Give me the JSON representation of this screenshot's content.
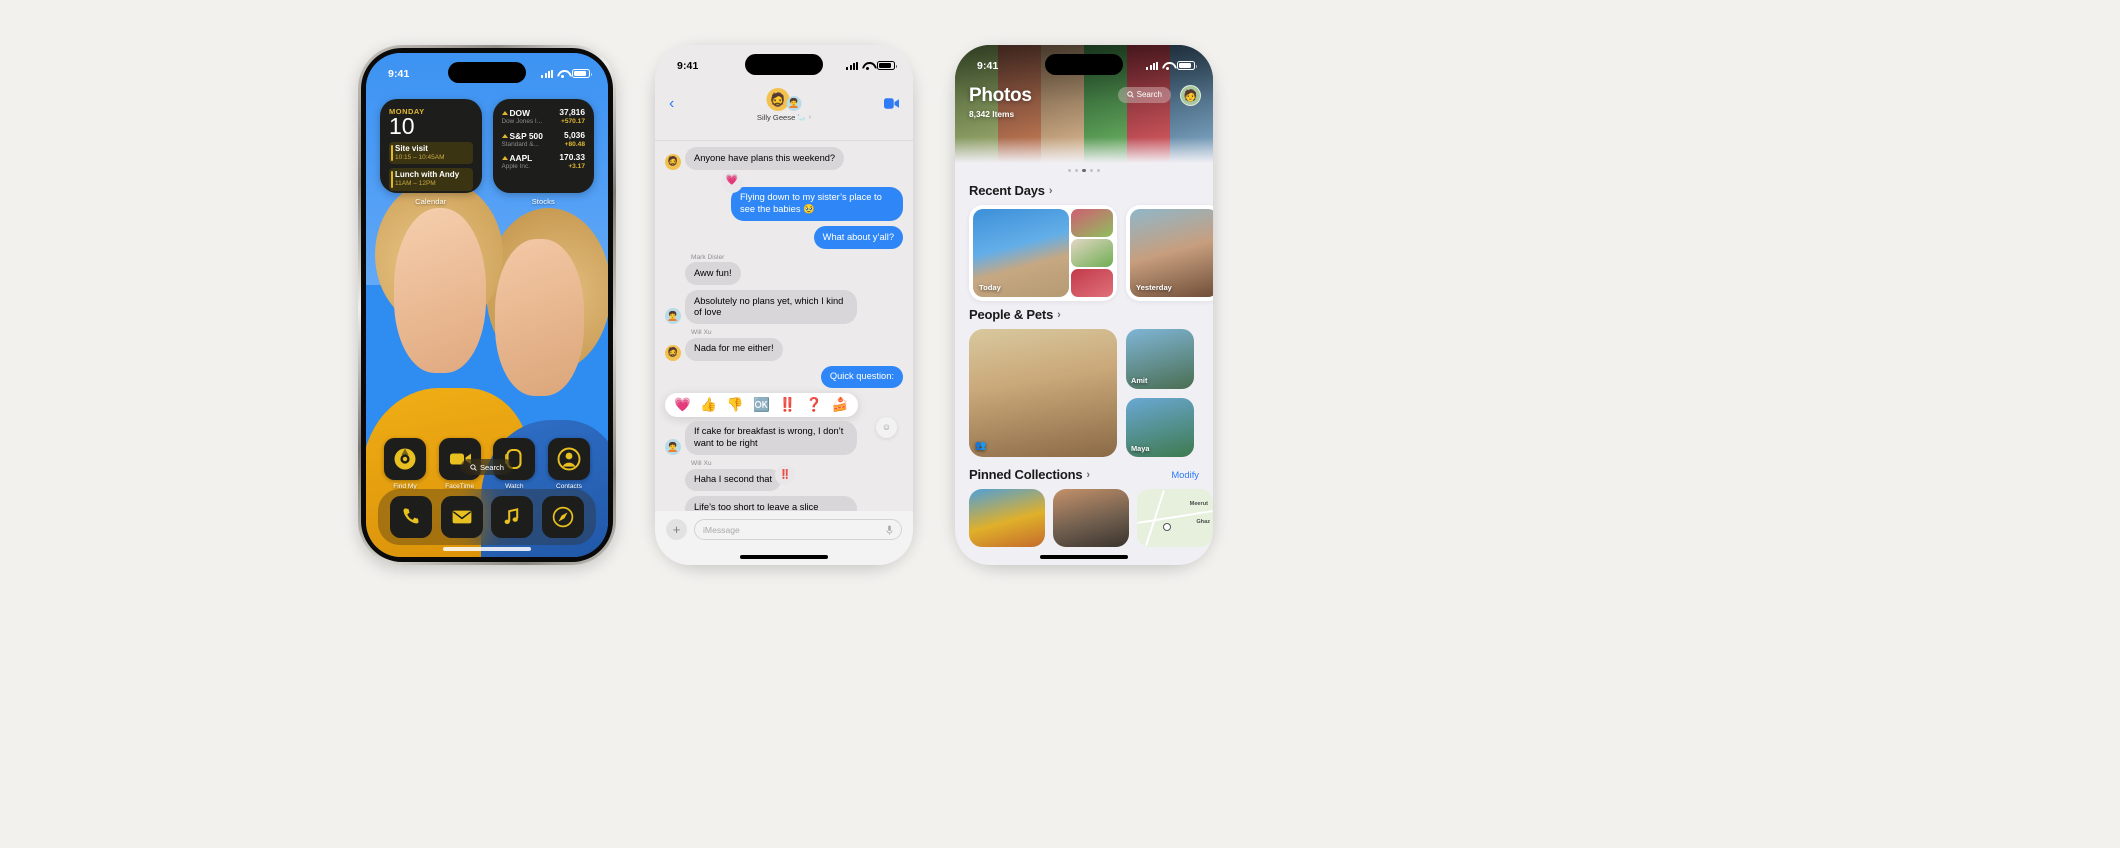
{
  "page": {
    "background": "#f2f1ee"
  },
  "phones": [
    {
      "id": "home-screen",
      "status_bar": {
        "time": "9:41",
        "signal_icon": "cellular-bars-icon",
        "wifi_icon": "wifi-icon",
        "battery_icon": "battery-icon"
      },
      "widgets": [
        {
          "name": "calendar",
          "label": "Calendar",
          "weekday": "MONDAY",
          "day": "10",
          "events": [
            {
              "title": "Site visit",
              "time": "10:15 – 10:45AM"
            },
            {
              "title": "Lunch with Andy",
              "time": "11AM – 12PM"
            }
          ]
        },
        {
          "name": "stocks",
          "label": "Stocks",
          "items": [
            {
              "symbol": "DOW",
              "company": "Dow Jones I...",
              "value": "37,816",
              "change": "+570.17"
            },
            {
              "symbol": "S&P 500",
              "company": "Standard &...",
              "value": "5,036",
              "change": "+80.48"
            },
            {
              "symbol": "AAPL",
              "company": "Apple Inc.",
              "value": "170.33",
              "change": "+3.17"
            }
          ]
        }
      ],
      "apps": [
        {
          "name": "Find My",
          "icon": "find-my-icon"
        },
        {
          "name": "FaceTime",
          "icon": "facetime-icon"
        },
        {
          "name": "Watch",
          "icon": "watch-icon"
        },
        {
          "name": "Contacts",
          "icon": "contacts-icon"
        }
      ],
      "search": {
        "label": "Search",
        "icon": "search-icon"
      },
      "dock": [
        {
          "name": "Phone",
          "icon": "phone-icon"
        },
        {
          "name": "Mail",
          "icon": "mail-icon"
        },
        {
          "name": "Music",
          "icon": "music-icon"
        },
        {
          "name": "Safari",
          "icon": "safari-icon"
        }
      ],
      "accent_color": "#e0b830"
    },
    {
      "id": "messages",
      "status_bar": {
        "time": "9:41"
      },
      "header": {
        "back_icon": "back-chevron-icon",
        "facetime_icon": "video-camera-icon",
        "group_name": "Silly Geese",
        "group_emoji": "🦢",
        "disclosure_icon": "chevron-right-icon"
      },
      "messages": [
        {
          "side": "in",
          "text": "Anyone have plans this weekend?",
          "avatar": "🧔",
          "sender": ""
        },
        {
          "side": "out",
          "text": "Flying down to my sister’s place to see the babies 🥹",
          "tapback": "💗"
        },
        {
          "side": "out",
          "text": "What about y’all?"
        },
        {
          "side": "in",
          "sender": "Mark Disler",
          "text": "Aww fun!"
        },
        {
          "side": "in",
          "text": "Absolutely no plans yet, which I kind of love",
          "avatar": "🧑‍🦱"
        },
        {
          "side": "in",
          "sender": "Will Xu",
          "text": "Nada for me either!",
          "avatar": "🧔"
        },
        {
          "side": "out",
          "text": "Quick question:"
        },
        {
          "side": "in",
          "text": "If cake for breakfast is wrong, I don’t want to be right",
          "avatar": "🧑‍🦱"
        },
        {
          "side": "in",
          "sender": "Will Xu",
          "text": "Haha I second that",
          "tapback": "‼️"
        },
        {
          "side": "in",
          "text": "Life’s too short to leave a slice behind",
          "avatar": "🧔"
        }
      ],
      "tapbacks": [
        "💗",
        "👍",
        "👎",
        "🆗",
        "‼️",
        "❓",
        "🍰"
      ],
      "input": {
        "placeholder": "iMessage",
        "plus_icon": "plus-icon",
        "mic_icon": "microphone-icon"
      }
    },
    {
      "id": "photos",
      "status_bar": {
        "time": "9:41"
      },
      "title": "Photos",
      "count": "8,342 Items",
      "search": {
        "label": "Search",
        "icon": "search-icon"
      },
      "avatar_icon": "account-avatar-icon",
      "sections": [
        {
          "title": "Recent Days",
          "chevron": "›",
          "cards": [
            {
              "tag": "Today"
            },
            {
              "tag": "Yesterday"
            }
          ]
        },
        {
          "title": "People & Pets",
          "chevron": "›",
          "people": [
            {
              "name": "",
              "icon": "group-people-icon"
            },
            {
              "name": "Amit"
            },
            {
              "name": "Maya"
            }
          ]
        },
        {
          "title": "Pinned Collections",
          "chevron": "›",
          "action": "Modify",
          "cards": [
            {
              "label": ""
            },
            {
              "label": ""
            },
            {
              "label": "Meerut",
              "sublabel": "Ghaz"
            }
          ]
        }
      ],
      "page_dots": {
        "count": 5,
        "active_index": 2
      },
      "accent_color": "#2f7cf6"
    }
  ]
}
